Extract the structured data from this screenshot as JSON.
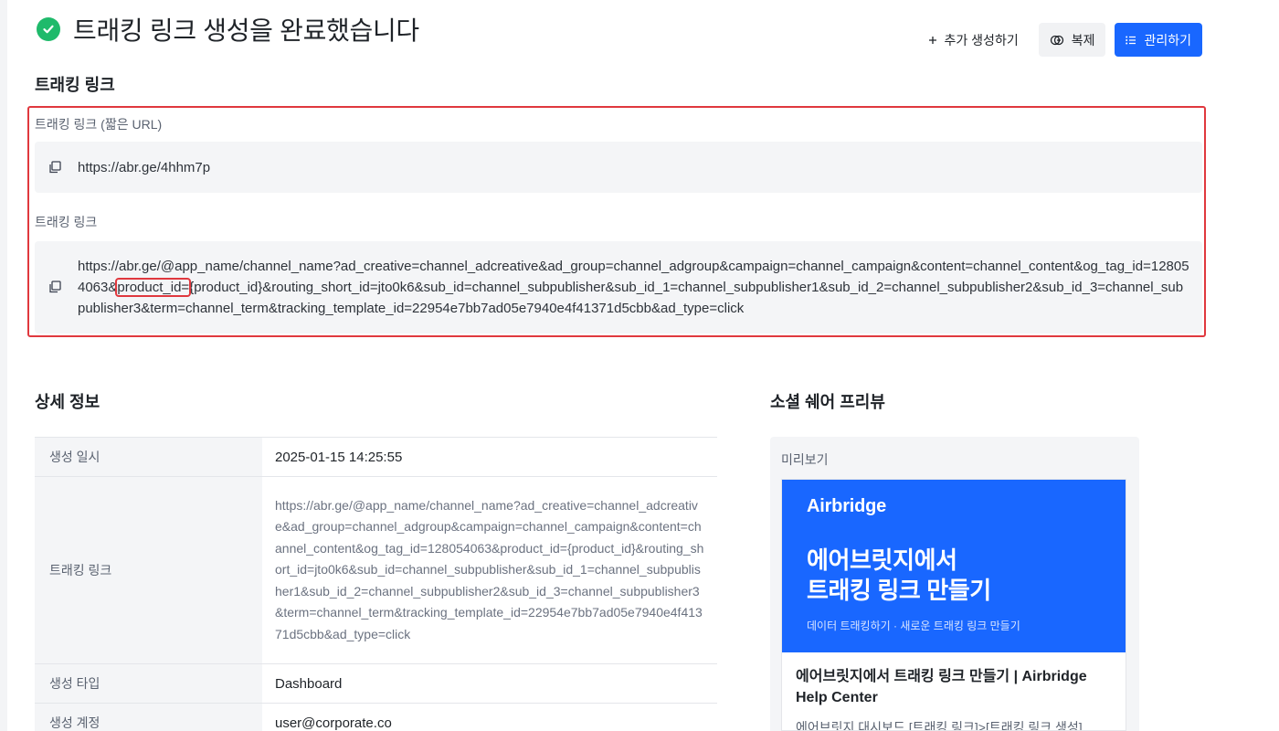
{
  "header": {
    "title": "트래킹 링크 생성을 완료했습니다"
  },
  "actions": {
    "add_label": "추가 생성하기",
    "duplicate_label": "복제",
    "manage_label": "관리하기"
  },
  "tracking_link_section": {
    "title": "트래킹 링크",
    "short_url_label": "트래킹 링크 (짧은 URL)",
    "short_url": "https://abr.ge/4hhm7p",
    "full_link_label": "트래킹 링크",
    "full_link_before": "https://abr.ge/@app_name/channel_name?ad_creative=channel_adcreative&ad_group=channel_adgroup&campaign=channel_campaign&content=channel_content&og_tag_id=128054063&",
    "full_link_highlight": "product_id=",
    "full_link_after": "{product_id}&routing_short_id=jto0k6&sub_id=channel_subpublisher&sub_id_1=channel_subpublisher1&sub_id_2=channel_subpublisher2&sub_id_3=channel_subpublisher3&term=channel_term&tracking_template_id=22954e7bb7ad05e7940e4f41371d5cbb&ad_type=click"
  },
  "details": {
    "title": "상세 정보",
    "rows": [
      {
        "key": "생성 일시",
        "value": "2025-01-15 14:25:55"
      },
      {
        "key": "트래킹 링크",
        "value": "https://abr.ge/@app_name/channel_name?ad_creative=channel_adcreative&ad_group=channel_adgroup&campaign=channel_campaign&content=channel_content&og_tag_id=128054063&product_id={product_id}&routing_short_id=jto0k6&sub_id=channel_subpublisher&sub_id_1=channel_subpublisher1&sub_id_2=channel_subpublisher2&sub_id_3=channel_subpublisher3&term=channel_term&tracking_template_id=22954e7bb7ad05e7940e4f41371d5cbb&ad_type=click"
      },
      {
        "key": "생성 타입",
        "value": "Dashboard"
      },
      {
        "key": "생성 계정",
        "value": "user@corporate.co"
      }
    ]
  },
  "social_preview": {
    "title": "소셜 쉐어 프리뷰",
    "preview_label": "미리보기",
    "brand": "Airbridge",
    "headline_line1": "에어브릿지에서",
    "headline_line2": "트래킹 링크 만들기",
    "image_subtitle": "데이터 트래킹하기 · 새로운 트래킹 링크 만들기",
    "card_title": "에어브릿지에서 트래킹 링크 만들기 | Airbridge Help Center",
    "card_description": "에어브릿지 대시보드 [트래킹 링크]>[트래킹 링크 생성]"
  },
  "colors": {
    "accent": "#1967ff",
    "success": "#1fba6b",
    "highlight_border": "#e0383e"
  }
}
